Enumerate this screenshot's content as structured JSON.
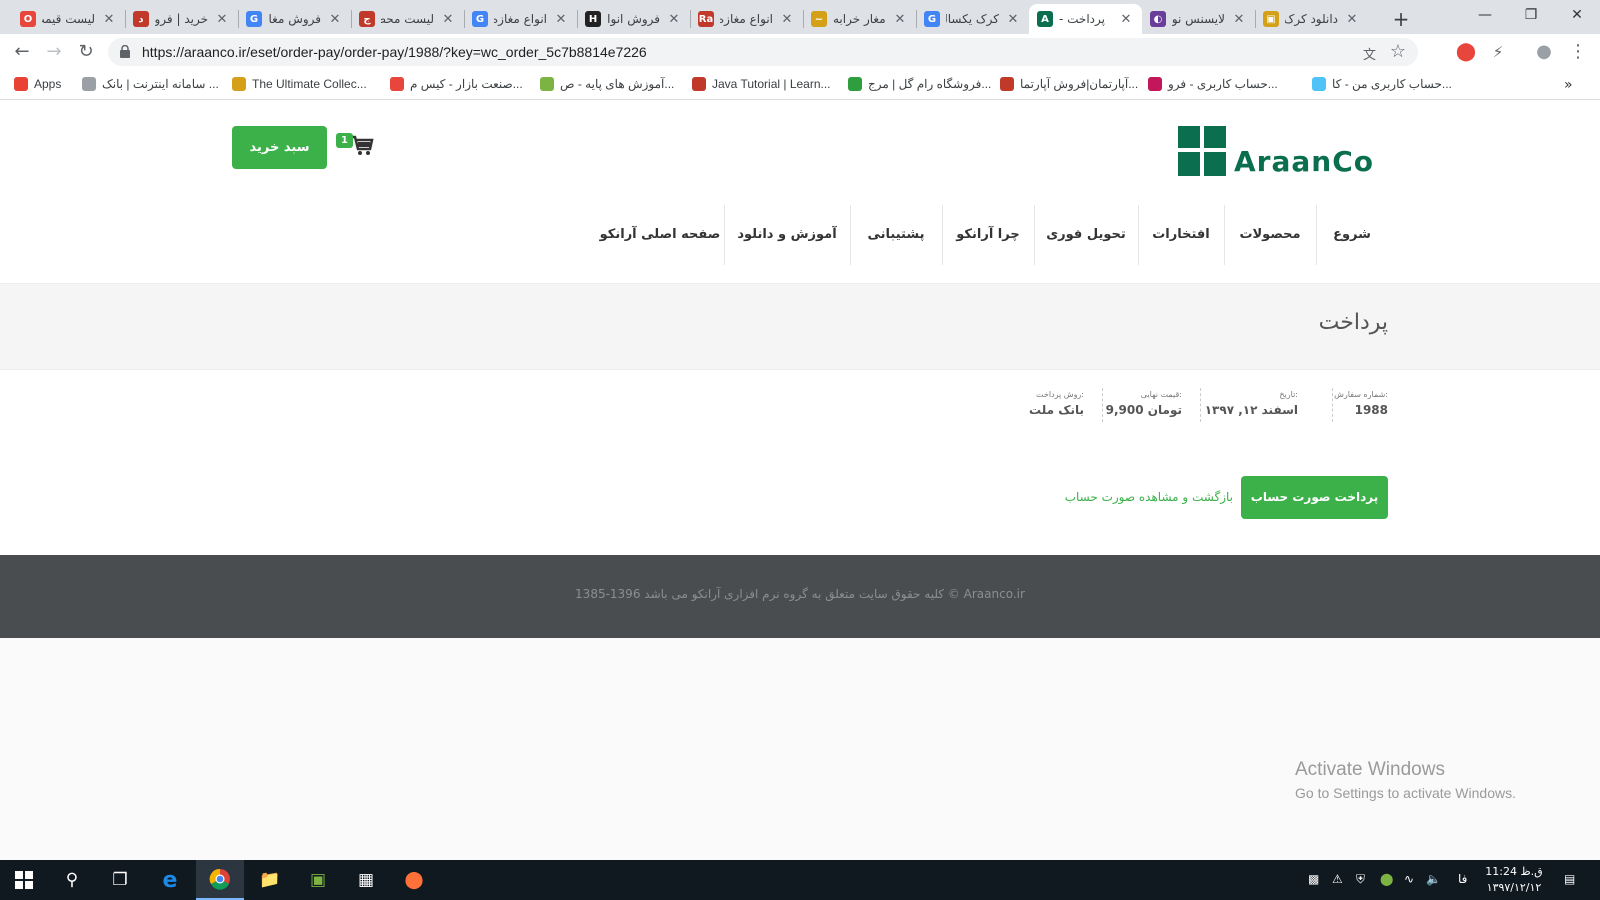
{
  "browser": {
    "tabs": [
      {
        "title": "لیست قیمت",
        "favicon_color": "#e8453c",
        "favicon": "O"
      },
      {
        "title": "خرید | فروش",
        "favicon_color": "#c0392b",
        "favicon": "د"
      },
      {
        "title": "فروش مغازه",
        "favicon_color": "#4285f4",
        "favicon": "G"
      },
      {
        "title": "لیست محصولات",
        "favicon_color": "#c0392b",
        "favicon": "ج"
      },
      {
        "title": "انواع مغازه",
        "favicon_color": "#4285f4",
        "favicon": "G"
      },
      {
        "title": "فروش انواع",
        "favicon_color": "#222222",
        "favicon": "H"
      },
      {
        "title": "انواع مغازه",
        "favicon_color": "#c0392b",
        "favicon": "Ra"
      },
      {
        "title": "مغار خرابه",
        "favicon_color": "#d4a017",
        "favicon": "~"
      },
      {
        "title": "کرک یکساله",
        "favicon_color": "#4285f4",
        "favicon": "G"
      },
      {
        "title": "پرداخت - ",
        "favicon_color": "#0b6e4f",
        "favicon": "A"
      },
      {
        "title": "لایسنس نود",
        "favicon_color": "#6a3d9a",
        "favicon": "◐"
      },
      {
        "title": "دانلود کرک",
        "favicon_color": "#d4a017",
        "favicon": "▣"
      }
    ],
    "url": "https://araanco.ir/eset/order-pay/order-pay/1988/?key=wc_order_5c7b8814e7226",
    "bookmarks": [
      {
        "label": "Apps",
        "color": "#e94235"
      },
      {
        "label": "سامانه اینترنت | بانک ...",
        "color": "#9aa0a6"
      },
      {
        "label": "The Ultimate Collec...",
        "color": "#d4a017"
      },
      {
        "label": "صنعت بازار - کیس م...",
        "color": "#e8453c"
      },
      {
        "label": "آموزش های پایه - ص...",
        "color": "#7cb342"
      },
      {
        "label": "Java Tutorial | Learn...",
        "color": "#c0392b"
      },
      {
        "label": "فروشگاه رام گل | مرج...",
        "color": "#2e9e3f"
      },
      {
        "label": "آپارتمان|فروش آپارتما...",
        "color": "#c0392b"
      },
      {
        "label": "حساب کاربری - فرو...",
        "color": "#c2185b"
      },
      {
        "label": "حساب کاربری من - کا...",
        "color": "#4fc3f7"
      }
    ]
  },
  "site": {
    "logo_text": "AraanCo",
    "cart_label": "سبد خرید",
    "cart_count": "1",
    "nav": [
      "شروع",
      "محصولات",
      "افتخارات",
      "تحویل فوری",
      "چرا آرانکو",
      "پشتیبانی",
      "آموزش و دانلود",
      "صفحه اصلی آرانکو"
    ],
    "page_title": "پرداخت",
    "order": {
      "number_label": "شماره سفارش:",
      "number_value": "1988",
      "date_label": "تاریخ:",
      "date_value": "اسفند ۱۲, ۱۳۹۷",
      "total_label": "قیمت نهایی:",
      "total_value": "9,900 تومان",
      "method_label": "روش پرداخت:",
      "method_value": "بانک ملت"
    },
    "pay_button": "پرداخت صورت حساب",
    "back_link": "بازگشت و مشاهده صورت حساب",
    "footer": "1385-1396 کلیه حقوق سایت متعلق به گروه نرم افزاری آرانکو می باشد © Araanco.ir"
  },
  "windows": {
    "activate_title": "Activate Windows",
    "activate_sub": "Go to Settings to activate Windows.",
    "lang": "فا",
    "time": "11:24 ق.ظ",
    "date": "۱۳۹۷/۱۲/۱۲"
  }
}
